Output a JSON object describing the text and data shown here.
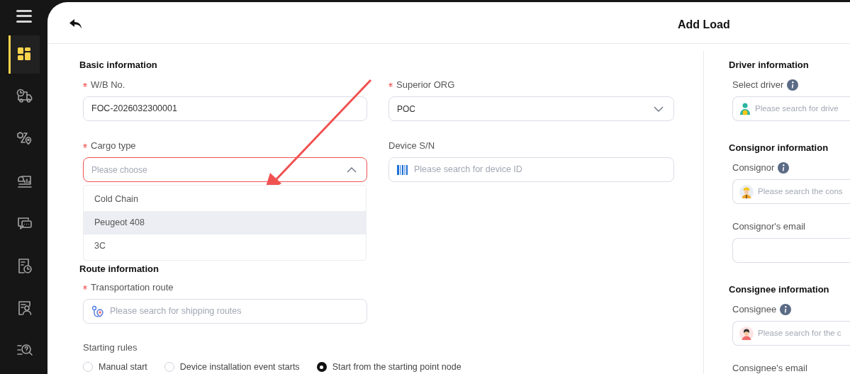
{
  "sidebar": {
    "items": [
      {
        "selected": true
      },
      {
        "selected": false
      },
      {
        "selected": false
      },
      {
        "selected": false
      },
      {
        "selected": false
      },
      {
        "selected": false
      },
      {
        "selected": false
      },
      {
        "selected": false
      }
    ]
  },
  "header": {
    "title": "Add Load"
  },
  "basic_information": {
    "title": "Basic information",
    "fields": [
      {
        "label": "W/B No.",
        "required": true,
        "kind": "text",
        "value": "FOC-2026032300001"
      },
      {
        "label": "Superior ORG",
        "required": true,
        "kind": "select",
        "value": "POC",
        "open": false
      },
      {
        "label": "Cargo type",
        "required": true,
        "kind": "select",
        "placeholder": "Please choose",
        "open": true,
        "error": true
      },
      {
        "label": "Device S/N",
        "kind": "search",
        "placeholder": "Please search for device ID"
      }
    ]
  },
  "cargo_type_options": [
    {
      "label": "Cold Chain",
      "highlighted": false
    },
    {
      "label": "Peugeot 408",
      "highlighted": true
    },
    {
      "label": "3C",
      "highlighted": false
    }
  ],
  "route_information": {
    "title": "Route information",
    "fields": [
      {
        "label": "Transportation route",
        "required": true,
        "kind": "search",
        "placeholder": "Please search for shipping routes"
      }
    ],
    "starting_rules": {
      "label": "Starting rules",
      "options": [
        {
          "label": "Manual start",
          "selected": false
        },
        {
          "label": "Device installation event starts",
          "selected": false
        },
        {
          "label": "Start from the starting point node",
          "selected": true
        }
      ]
    }
  },
  "side_sections": [
    {
      "title": "Driver information",
      "fields": [
        {
          "label": "Select driver",
          "info": true,
          "kind": "search",
          "placeholder": "Please search for drive"
        }
      ]
    },
    {
      "title": "Consignor information",
      "fields": [
        {
          "label": "Consignor",
          "info": true,
          "kind": "search",
          "placeholder": "Please search the cons"
        },
        {
          "label": "Consignor's email",
          "kind": "text"
        }
      ]
    },
    {
      "title": "Consignee information",
      "fields": [
        {
          "label": "Consignee",
          "info": true,
          "kind": "search",
          "placeholder": "Please search for the c"
        },
        {
          "label": "Consignee's email",
          "kind": "label_only"
        }
      ]
    }
  ]
}
